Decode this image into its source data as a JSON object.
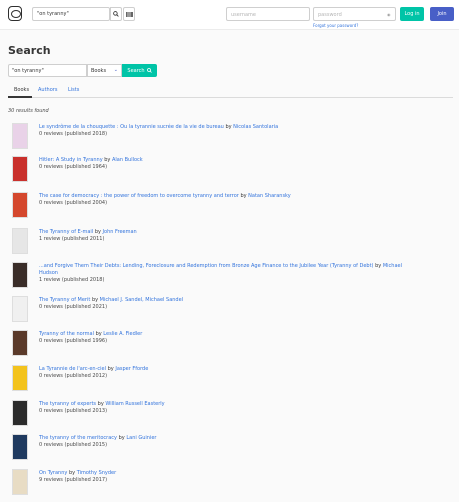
{
  "nav": {
    "search_value": "\"on tyranny\"",
    "username_placeholder": "username",
    "password_placeholder": "password",
    "forgot_link": "Forgot your password?",
    "login_label": "Log in",
    "join_label": "Join"
  },
  "page": {
    "title": "Search",
    "search_value": "\"on tyranny\"",
    "type_selected": "Books",
    "search_button": "Search",
    "results_count": "30 results found"
  },
  "tabs": [
    {
      "label": "Books",
      "active": true
    },
    {
      "label": "Authors",
      "active": false
    },
    {
      "label": "Lists",
      "active": false
    }
  ],
  "results": [
    {
      "title": "Le syndrôme de la chouquette : Ou la tyrannie sucrée de la vie de bureau",
      "authors": "Nicolas Santolaria",
      "meta": "0 reviews (published 2018)",
      "cover_color": "#e9d2e8"
    },
    {
      "title": "Hitler: A Study in Tyranny",
      "authors": "Alan Bullock",
      "meta": "0 reviews (published 1964)",
      "cover_color": "#c9302c"
    },
    {
      "title": "The case for democracy : the power of freedom to overcome tyranny and terror",
      "authors": "Natan Sharansky",
      "meta": "0 reviews (published 2004)",
      "cover_color": "#d4472d"
    },
    {
      "title": "The Tyranny of E-mail",
      "authors": "John Freeman",
      "meta": "1 review (published 2011)",
      "cover_color": "#e6e6e6"
    },
    {
      "title": "...and Forgive Them Their Debts: Lending, Foreclosure and Redemption from Bronze Age Finance to the Jubilee Year (Tyranny of Debt)",
      "authors": "Michael Hudson",
      "meta": "1 review (published 2018)",
      "cover_color": "#3a2d28"
    },
    {
      "title": "The Tyranny of Merit",
      "authors": "Michael J. Sandel, Michael Sandel",
      "meta": "0 reviews (published 2021)",
      "cover_color": "#f0f0f0"
    },
    {
      "title": "Tyranny of the normal",
      "authors": "Leslie A. Fiedler",
      "meta": "0 reviews (published 1996)",
      "cover_color": "#5a3a2a"
    },
    {
      "title": "La Tyrannie de l'arc-en-ciel",
      "authors": "Jasper Fforde",
      "meta": "0 reviews (published 2012)",
      "cover_color": "#f3c31d"
    },
    {
      "title": "The tyranny of experts",
      "authors": "William Russell Easterly",
      "meta": "0 reviews (published 2013)",
      "cover_color": "#2b2b2b"
    },
    {
      "title": "The tyranny of the meritocracy",
      "authors": "Lani Guinier",
      "meta": "0 reviews (published 2015)",
      "cover_color": "#1f3a5f"
    },
    {
      "title": "On Tyranny",
      "authors": "Timothy Snyder",
      "meta": "9 reviews (published 2017)",
      "cover_color": "#e8dcc4"
    }
  ],
  "by_word": "by",
  "colors": {
    "accent": "#00c4a7",
    "link": "#3273dc",
    "join": "#485fc7"
  }
}
